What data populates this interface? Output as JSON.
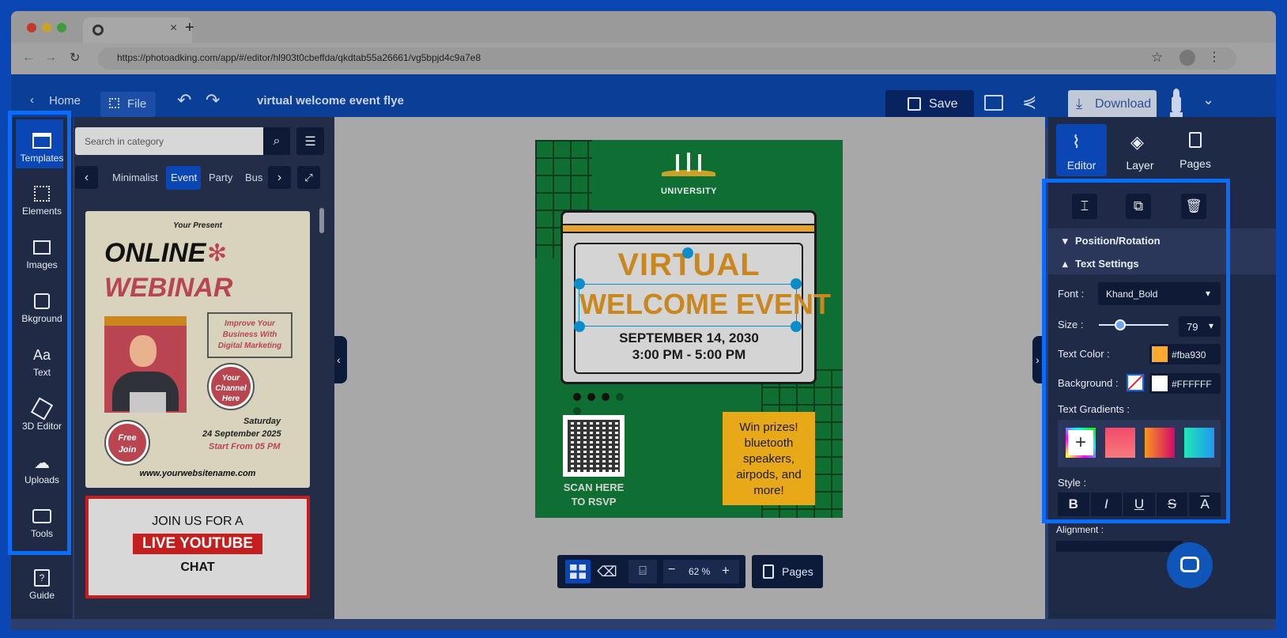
{
  "browser": {
    "url": "https://photoadking.com/app/#/editor/hl903t0cbeffda/qkdtab55a26661/vg5bpjd4c9a7e8",
    "new_tab_label": "+",
    "tab_close": "×"
  },
  "header": {
    "home_label": "Home",
    "file_label": "File",
    "doc_title": "virtual welcome event flye",
    "save_label": "Save",
    "download_label": "Download"
  },
  "left_nav": {
    "items": [
      {
        "label": "Templates",
        "icon": "templates-icon"
      },
      {
        "label": "Elements",
        "icon": "elements-icon"
      },
      {
        "label": "Images",
        "icon": "images-icon"
      },
      {
        "label": "Bkground",
        "icon": "background-icon"
      },
      {
        "label": "Text",
        "icon": "text-icon"
      },
      {
        "label": "3D Editor",
        "icon": "3d-editor-icon"
      },
      {
        "label": "Uploads",
        "icon": "uploads-icon"
      },
      {
        "label": "Tools",
        "icon": "tools-icon"
      }
    ],
    "guide_label": "Guide"
  },
  "template_panel": {
    "search_placeholder": "Search in category",
    "categories": [
      "Minimalist",
      "Event",
      "Party",
      "Bus"
    ],
    "active_category": "Event",
    "card1": {
      "your_present": "Your Present",
      "online": "ONLINE",
      "webinar": "WEBINAR",
      "bubble": "Improve Your Business With Digital Marketing",
      "channel": "Your Channel Here",
      "free_join": "Free Join",
      "saturday": "Saturday",
      "date": "24 September 2025",
      "start": "Start From 05 PM",
      "website": "www.yourwebsitename.com"
    },
    "card2": {
      "line1": "JOIN US FOR A",
      "line2": "LIVE YOUTUBE",
      "line3": "CHAT"
    }
  },
  "poster": {
    "university": "UNIVERSITY",
    "virtual": "VIRTUAL",
    "welcome": "WELCOME EVENT",
    "date": "SEPTEMBER 14, 2030",
    "time": "3:00 PM - 5:00 PM",
    "scan": "SCAN HERE",
    "rsvp": "TO RSVP",
    "prize": "Win prizes! bluetooth speakers, airpods, and more!"
  },
  "canvas_toolbar": {
    "zoom": "62 %",
    "minus": "−",
    "plus": "+",
    "pages_label": "Pages"
  },
  "right_panel": {
    "tabs": [
      {
        "label": "Editor",
        "icon": "editor-icon"
      },
      {
        "label": "Layer",
        "icon": "layer-icon"
      },
      {
        "label": "Pages",
        "icon": "pages-icon"
      }
    ],
    "position_rotation": "Position/Rotation",
    "text_settings": "Text Settings",
    "font_label": "Font :",
    "font_value": "Khand_Bold",
    "size_label": "Size :",
    "size_value": "79",
    "text_color_label": "Text Color :",
    "text_color_value": "#fba930",
    "background_label": "Background :",
    "background_value": "#FFFFFF",
    "gradients_label": "Text Gradients :",
    "style_label": "Style :",
    "alignment_label": "Alignment :",
    "style_buttons": [
      "B",
      "I",
      "U",
      "S",
      "A"
    ]
  },
  "colors": {
    "accent": "#0a6cff",
    "poster_green": "#0f6e32",
    "poster_orange": "#c9871e",
    "text_color": "#fba930"
  }
}
